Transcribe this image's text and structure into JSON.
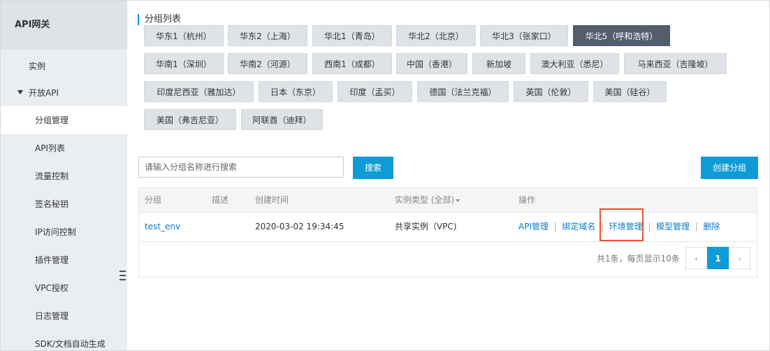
{
  "sidebar": {
    "title": "API网关",
    "items": [
      {
        "label": "实例"
      },
      {
        "label": "开放API"
      },
      {
        "label": "分组管理"
      },
      {
        "label": "API列表"
      },
      {
        "label": "流量控制"
      },
      {
        "label": "签名秘钥"
      },
      {
        "label": "IP访问控制"
      },
      {
        "label": "插件管理"
      },
      {
        "label": "VPC授权"
      },
      {
        "label": "日志管理"
      },
      {
        "label": "SDK/文档自动生成"
      }
    ]
  },
  "main": {
    "title": "分组列表",
    "regions": [
      "华东1（杭州）",
      "华东2（上海）",
      "华北1（青岛）",
      "华北2（北京）",
      "华北3（张家口）",
      "华北5（呼和浩特）",
      "华南1（深圳）",
      "华南2（河源）",
      "西南1（成都）",
      "中国（香港）",
      "新加坡",
      "澳大利亚（悉尼）",
      "马来西亚（吉隆坡）",
      "印度尼西亚（雅加达）",
      "日本（东京）",
      "印度（孟买）",
      "德国（法兰克福）",
      "英国（伦敦）",
      "美国（硅谷）",
      "美国（弗吉尼亚）",
      "阿联酋（迪拜）"
    ],
    "selected_region": "华北5（呼和浩特）",
    "search_placeholder": "请输入分组名称进行搜索",
    "search_button": "搜索",
    "create_button": "创建分组",
    "table": {
      "headers": [
        "分组",
        "描述",
        "创建时间",
        "实例类型 (全部)",
        "操作"
      ],
      "rows": [
        {
          "group": "test_env",
          "description": "",
          "created": "2020-03-02 19:34:45",
          "instance_type": "共享实例（VPC)",
          "actions": [
            "API管理",
            "绑定域名",
            "环境管理",
            "模型管理",
            "删除"
          ]
        }
      ]
    },
    "pagination": {
      "summary": "共1条，每页显示10条",
      "prev": "‹",
      "current": "1",
      "next": "›"
    }
  },
  "colors": {
    "accent": "#0e9bd6",
    "selected_region_bg": "#525d6d",
    "highlight_border": "#e8542d",
    "sidebar_bg": "#eaedf1"
  }
}
